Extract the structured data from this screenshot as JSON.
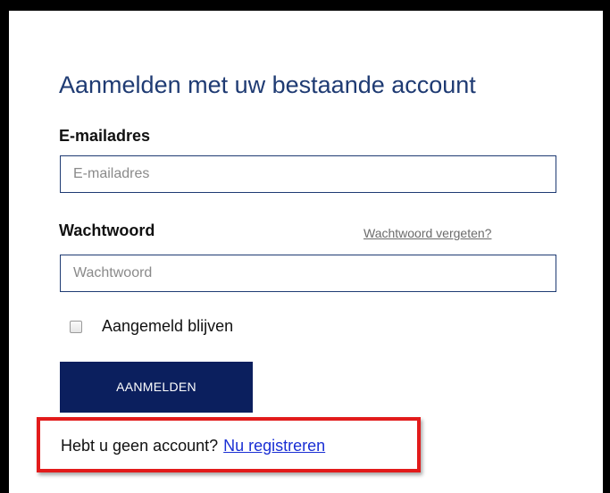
{
  "form": {
    "title": "Aanmelden met uw bestaande account",
    "email_label": "E-mailadres",
    "email_placeholder": "E-mailadres",
    "email_value": "",
    "password_label": "Wachtwoord",
    "password_placeholder": "Wachtwoord",
    "password_value": "",
    "forgot_link": "Wachtwoord vergeten?",
    "remember_label": "Aangemeld blijven",
    "remember_checked": false,
    "submit_label": "AANMELDEN"
  },
  "signup": {
    "prompt": "Hebt u geen account?",
    "link": "Nu registreren"
  },
  "colors": {
    "title": "#1f3b73",
    "button_bg": "#0b1f5e",
    "link": "#1a2fd4",
    "highlight": "#e21b1b"
  }
}
